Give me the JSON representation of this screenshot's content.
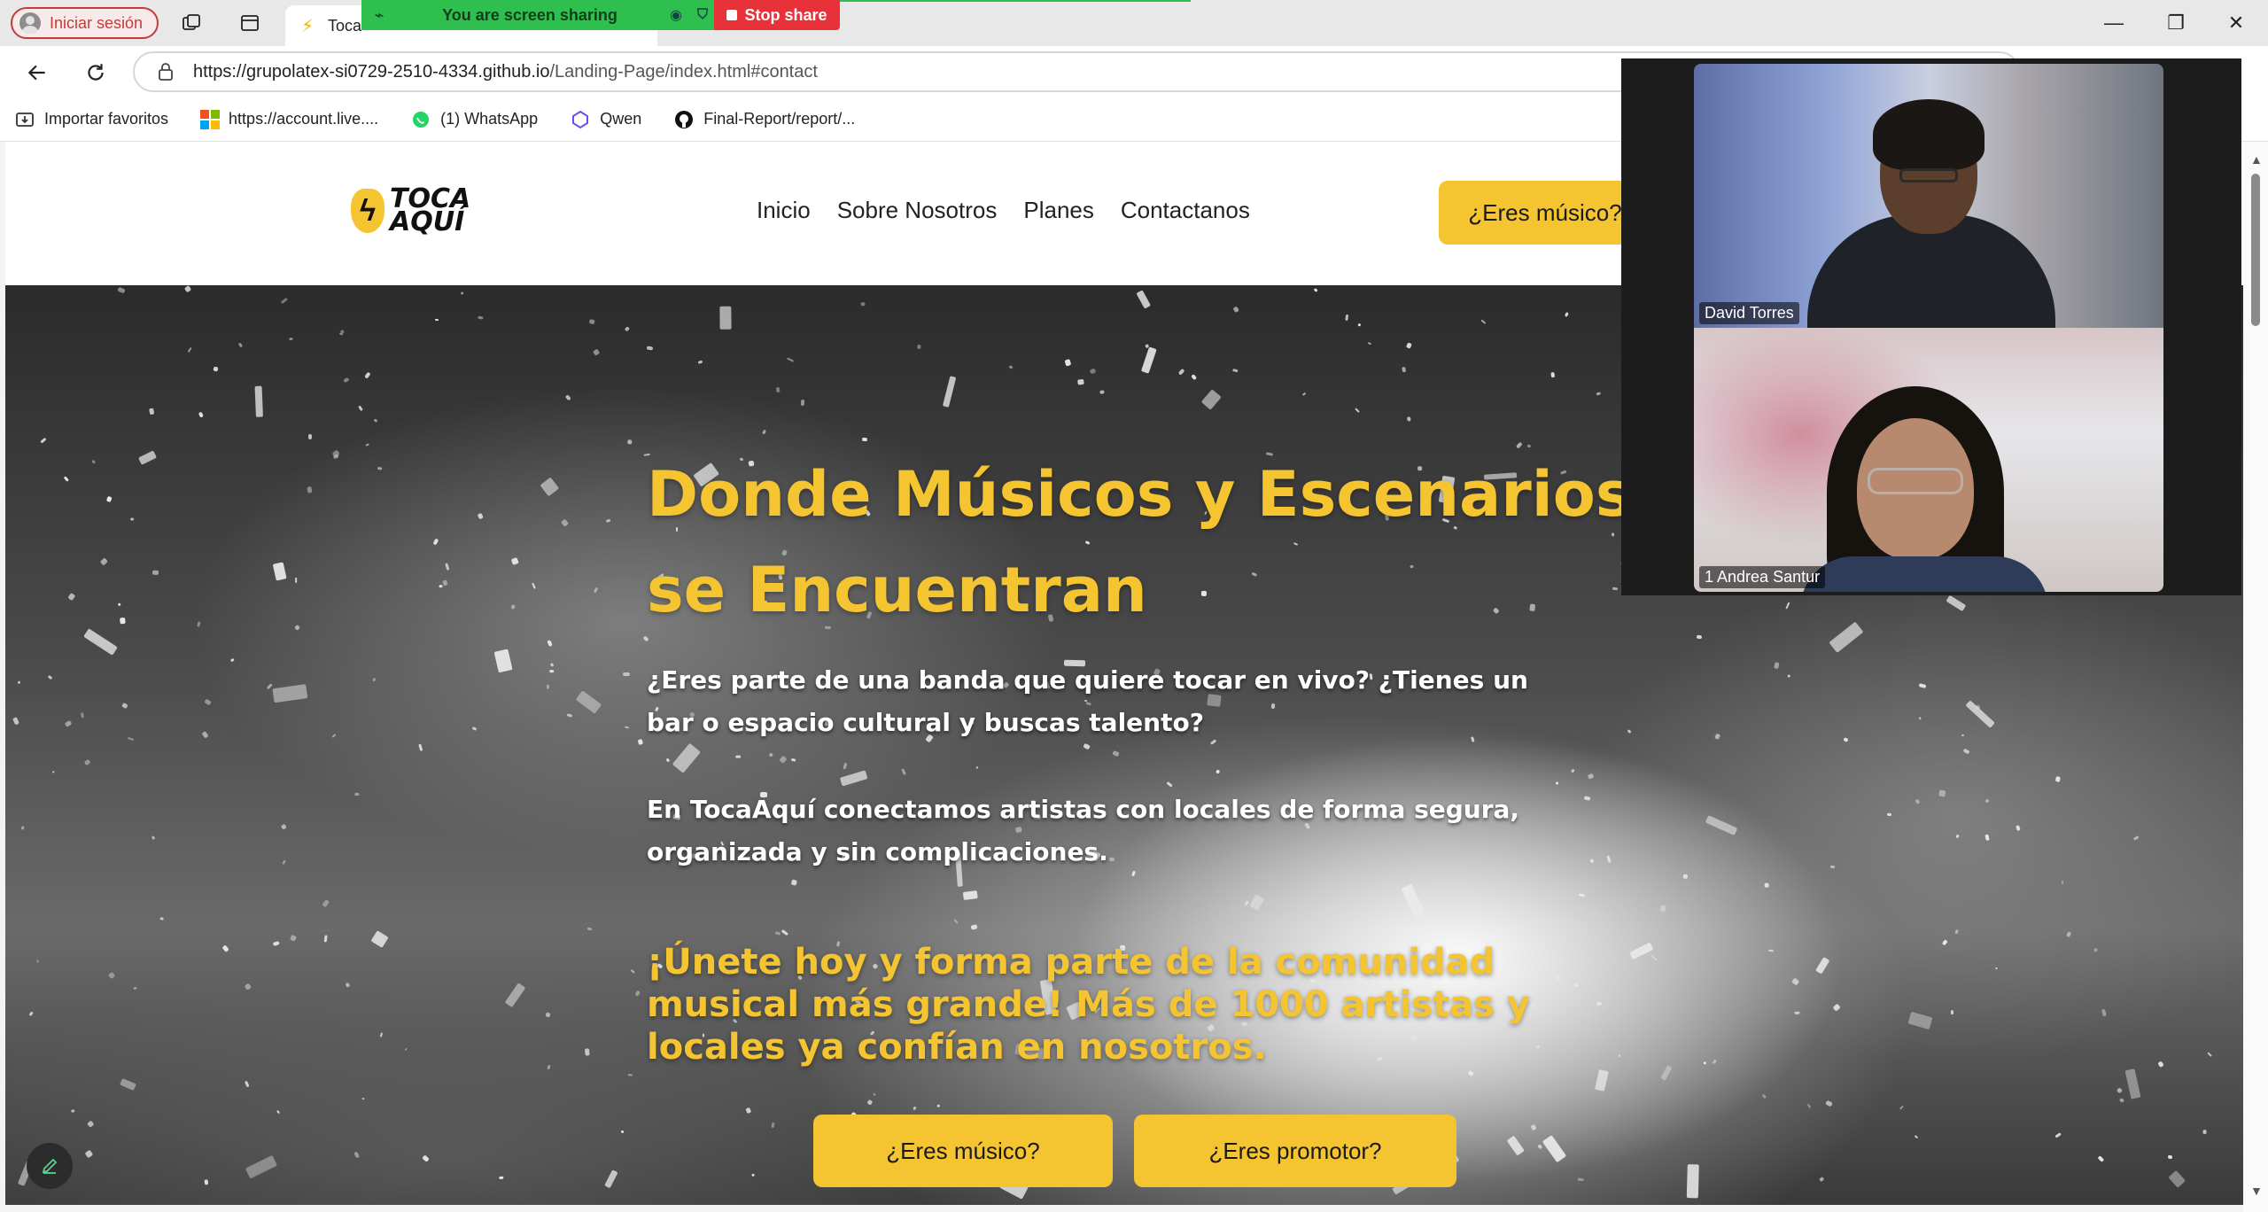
{
  "browser": {
    "profile_label": "Iniciar sesión",
    "tab_title": "Toca",
    "url_host": "https://grupolatex-si0729-2510-4334.github.io",
    "url_path": "/Landing-Page/index.html#contact",
    "icons": {
      "workspaces": "workspaces-icon",
      "tabs": "tab-actions-icon",
      "back": "back-arrow-icon",
      "refresh": "refresh-icon",
      "lock": "lock-icon"
    }
  },
  "screen_share": {
    "message": "You are screen sharing",
    "stop_label": "Stop share",
    "accent": "#2fbf4f",
    "stop_color": "#e8323a"
  },
  "favorites": [
    {
      "label": "Importar favoritos",
      "icon": "import-favorites-icon"
    },
    {
      "label": "https://account.live....",
      "icon": "microsoft-logo-icon"
    },
    {
      "label": "(1) WhatsApp",
      "icon": "whatsapp-icon"
    },
    {
      "label": "Qwen",
      "icon": "qwen-icon"
    },
    {
      "label": "Final-Report/report/...",
      "icon": "github-icon"
    }
  ],
  "site": {
    "logo_line1": "TOCA",
    "logo_line2": "AQUÍ",
    "nav": [
      "Inicio",
      "Sobre Nosotros",
      "Planes",
      "Contactanos"
    ],
    "header_cta": "¿Eres músico?",
    "brand_yellow": "#f5c431"
  },
  "hero": {
    "title": "Donde Músicos y Escenarios se Encuentran",
    "paragraph1": "¿Eres parte de una banda que quiere tocar en vivo? ¿Tienes un bar o espacio cultural y buscas talento?",
    "paragraph2_prefix": "En ",
    "paragraph2_brand": "TocaAquí",
    "paragraph2_rest": " conectamos artistas con locales de forma segura, organizada y sin complicaciones.",
    "join_text": "¡Únete hoy y forma parte de la comunidad musical más grande! Más de 1000 artistas y locales ya confían en nosotros.",
    "btn_musician": "¿Eres músico?",
    "btn_promoter": "¿Eres promotor?"
  },
  "video_call": {
    "participants": [
      {
        "name": "David Torres"
      },
      {
        "name": "1 Andrea Santur"
      }
    ]
  }
}
